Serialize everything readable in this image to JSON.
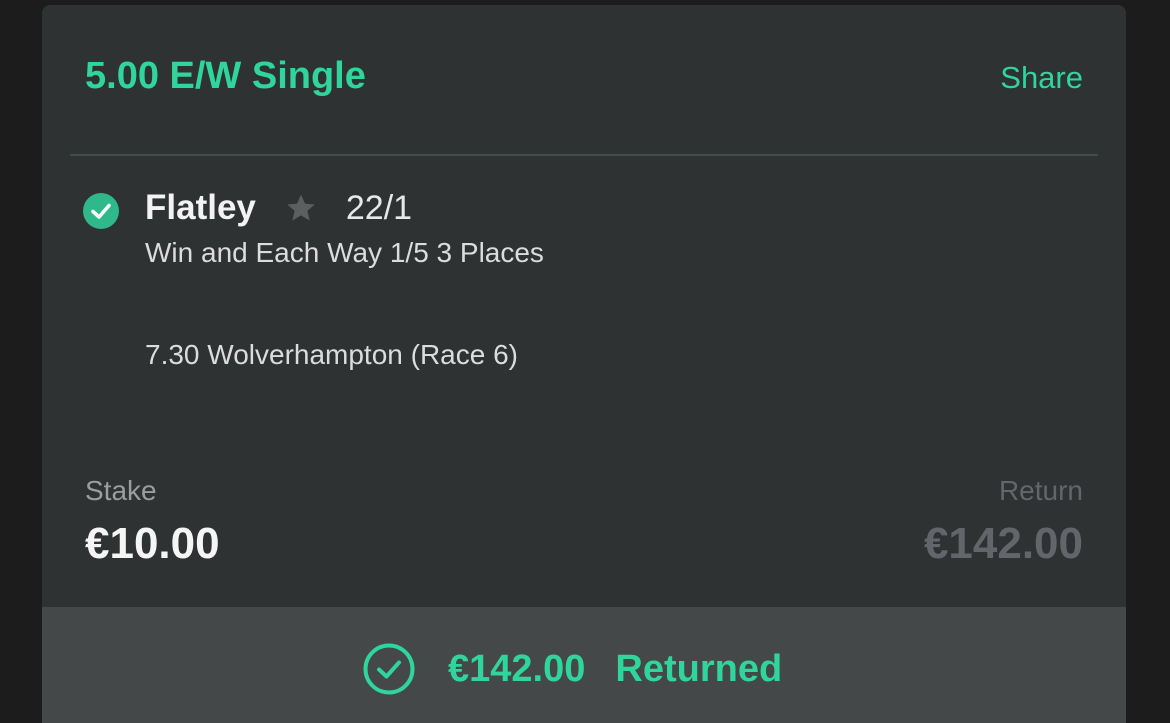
{
  "bet": {
    "type_label": "5.00 E/W Single",
    "share_label": "Share"
  },
  "selection": {
    "name": "Flatley",
    "odds": "22/1",
    "market": "Win and Each Way 1/5 3 Places",
    "event": "7.30 Wolverhampton (Race 6)",
    "status_icon": "check-circle-icon",
    "favourite_icon": "star-icon"
  },
  "stake": {
    "label": "Stake",
    "value": "€10.00"
  },
  "return": {
    "label": "Return",
    "value": "€142.00"
  },
  "footer": {
    "amount": "€142.00",
    "status": "Returned",
    "icon": "check-circle-outline-icon"
  },
  "colors": {
    "accent": "#2fd59a",
    "card_background": "#2e3232",
    "footer_background": "#444848",
    "muted_text": "#62666a"
  }
}
